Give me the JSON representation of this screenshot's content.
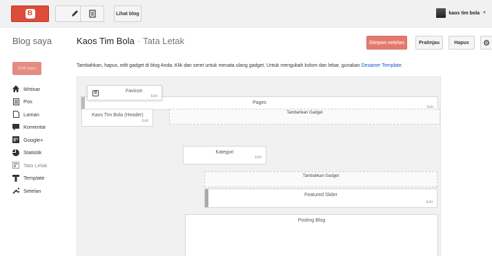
{
  "topbar": {
    "view_blog": "Lihat blog",
    "user": "kaos tim bola"
  },
  "header": {
    "blog_saya": "Blog saya",
    "blog_name": "Kaos Tim Bola",
    "separator": "·",
    "section": "Tata Letak",
    "save": "Simpan setelan",
    "preview": "Pratinjau",
    "delete": "Hapus"
  },
  "sidebar": {
    "new_post": "Entri baru",
    "items": [
      {
        "label": "Ikhtisar",
        "icon": "home-icon"
      },
      {
        "label": "Pos",
        "icon": "posts-icon"
      },
      {
        "label": "Laman",
        "icon": "pages-icon"
      },
      {
        "label": "Komentar",
        "icon": "comment-icon"
      },
      {
        "label": "Google+",
        "icon": "google-plus-icon"
      },
      {
        "label": "Statistik",
        "icon": "stats-icon"
      },
      {
        "label": "Tata Letak",
        "icon": "layout-icon"
      },
      {
        "label": "Template",
        "icon": "template-icon"
      },
      {
        "label": "Setelan",
        "icon": "settings-icon"
      }
    ]
  },
  "main": {
    "description": "Tambahkan, hapus, edit gadget di blog Anda. Klik dan seret untuk menata ulang gadget. Untuk mengubah kolom dan lebar, gunakan ",
    "description_link": "Desainer Template",
    "description_end": ".",
    "gadgets": {
      "favicon": "Favicon",
      "pages": "Pages",
      "header": "Kaos Tim Bola (Header)",
      "kategori": "Kategori",
      "featured": "Featured Slider",
      "posting": "Posting Blog",
      "edit": "Edit",
      "add_gadget": "Tambahkan Gadget"
    }
  }
}
